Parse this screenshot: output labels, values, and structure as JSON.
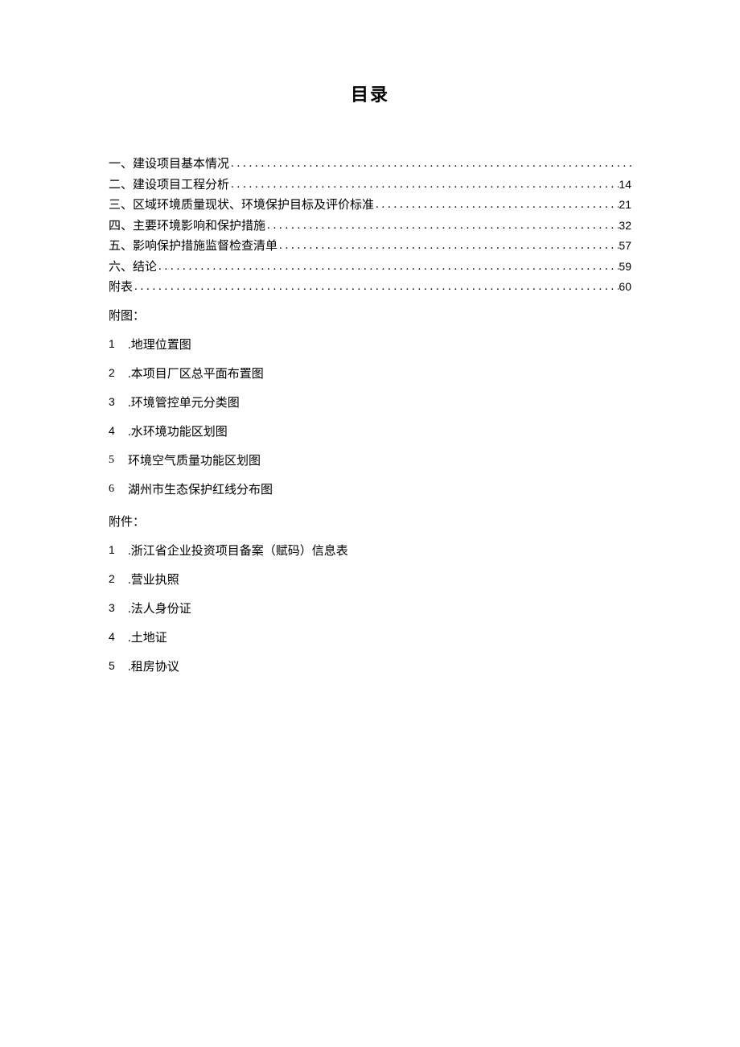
{
  "title": "目录",
  "toc": [
    {
      "label": "一、建设项目基本情况",
      "page": ""
    },
    {
      "label": "二、建设项目工程分析",
      "page": "14"
    },
    {
      "label": "三、区域环境质量现状、环境保护目标及评价标准",
      "page": "21"
    },
    {
      "label": "四、主要环境影响和保护措施",
      "page": "32"
    },
    {
      "label": "五、影响保护措施监督检查清单",
      "page": "57"
    },
    {
      "label": "六、结论",
      "page": "59"
    },
    {
      "label": "附表",
      "page": "60"
    }
  ],
  "futu_label": "附图：",
  "futu_items": [
    {
      "num": "1",
      "text": ".地理位置图"
    },
    {
      "num": "2",
      "text": "  .本项目厂区总平面布置图"
    },
    {
      "num": "3",
      "text": "  .环境管控单元分类图"
    },
    {
      "num": "4",
      "text": "  .水环境功能区划图"
    },
    {
      "num": "5",
      "text": "环境空气质量功能区划图"
    },
    {
      "num": "6",
      "text": "湖州市生态保护红线分布图"
    }
  ],
  "fujian_label": "附件：",
  "fujian_items": [
    {
      "num": "1",
      "text": ".浙江省企业投资项目备案（赋码）信息表"
    },
    {
      "num": "2",
      "text": "  .营业执照"
    },
    {
      "num": "3",
      "text": "  .法人身份证"
    },
    {
      "num": "4",
      "text": "  .土地证"
    },
    {
      "num": "5",
      "text": "  .租房协议"
    }
  ]
}
